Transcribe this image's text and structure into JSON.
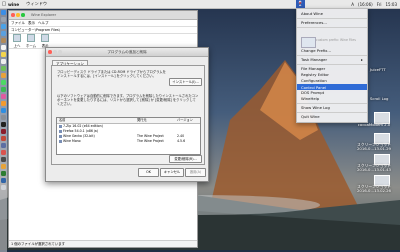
{
  "menubar": {
    "app": "wine",
    "items": [
      "ウィンドウ"
    ],
    "right": [
      "A",
      "(16:06)",
      "Fri",
      "15:03"
    ]
  },
  "wine_menu": {
    "items": [
      "About Wine",
      "Preferences...",
      "custom prefix: Wine Files",
      "Change Prefix...",
      "Task Manager",
      "File Manager",
      "Registry Editor",
      "Configuration",
      "Control Panel",
      "DOS Prompt",
      "WineHelp",
      "Show Wine Log",
      "Quit Wine"
    ],
    "highlighted": "Control Panel"
  },
  "explorer_window": {
    "title": "Wine Explorer",
    "menu": [
      "ファイル",
      "表示",
      "ヘルプ"
    ],
    "path_label": "コンピューター\\Program Files\\",
    "toolbar": [
      "上へ",
      "ホーム",
      "表示"
    ],
    "status": "1 個のファイルが選択されています"
  },
  "dialog": {
    "title": "プログラムの追加と削除",
    "tab": "アプリケーション",
    "install_text": "フロッピーディスク ドライブまたは CD-ROM ドライブからプログラムをインストールするには、[インストール] をクリックしてください。",
    "install_button": "インストール(I)...",
    "remove_text": "以下のソフトウェアは自動的に削除できます。プログラムを削除したりインストールされたコンポーネントを変更したりするには、リストから選択して [削除] か [変更/削除] をクリックしてください。",
    "columns": [
      "名前",
      "発行元",
      "バージョン"
    ],
    "rows": [
      {
        "name": "7-Zip 16.02 (x64 edition)",
        "publisher": "",
        "version": ""
      },
      {
        "name": "Firefox 54.0.1 (x86 ja)",
        "publisher": "",
        "version": ""
      },
      {
        "name": "Wine Gecko (32-bit)",
        "publisher": "The Wine Project",
        "version": "2.40"
      },
      {
        "name": "Wine Mono",
        "publisher": "The Wine Project",
        "version": "4.5.6"
      }
    ],
    "buttons": [
      "変更/削除(R)...",
      "OK",
      "キャンセル",
      "適用(A)"
    ]
  },
  "desktop": {
    "labels": [
      "cocoaModem 2.0",
      "スクリーンショット\n2016-0...13.01.29",
      "スクリーンショット\n2016-0...13.01.43",
      "スクリーンショット\n2016-0...13.02.26"
    ],
    "other": [
      "JuiceFTT",
      "Scroll Log"
    ]
  }
}
